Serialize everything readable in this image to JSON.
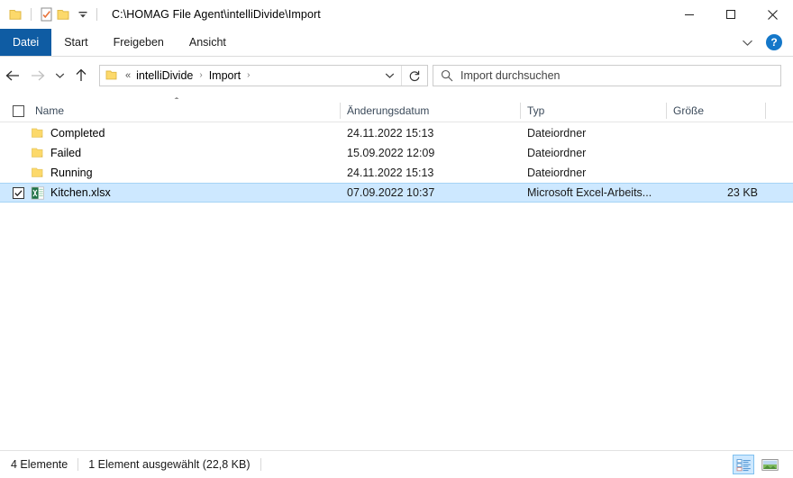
{
  "window": {
    "title": "C:\\HOMAG File Agent\\intelliDivide\\Import",
    "quick_access": [
      {
        "name": "folder-icon",
        "label": "Eigenschaften"
      },
      {
        "name": "properties-icon",
        "label": "Eigenschaften"
      },
      {
        "name": "new-folder-icon",
        "label": "Neuer Ordner"
      },
      {
        "name": "chevron-down-icon",
        "label": "Symbolleiste für den Schnellzugriff anpassen"
      }
    ],
    "controls": {
      "minimize": "—",
      "maximize": "□",
      "close": "✕"
    }
  },
  "ribbon": {
    "tabs": [
      {
        "label": "Datei",
        "active": true
      },
      {
        "label": "Start",
        "active": false
      },
      {
        "label": "Freigeben",
        "active": false
      },
      {
        "label": "Ansicht",
        "active": false
      }
    ],
    "expand_label": "Menüband minimieren",
    "help_label": "?"
  },
  "navigation": {
    "back_label": "Zurück",
    "forward_label": "Vorwärts",
    "recent_label": "Zuletzt besuchte Orte",
    "up_label": "Eine Ebene nach oben",
    "breadcrumb": {
      "overflow": "«",
      "items": [
        "intelliDivide",
        "Import"
      ],
      "separator": "›"
    },
    "address_dropdown_label": "Vorherige Orte",
    "refresh_label": "Aktualisieren"
  },
  "search": {
    "placeholder": "Import durchsuchen",
    "icon": "search-icon"
  },
  "columns": [
    {
      "key": "name",
      "label": "Name",
      "sorted": true,
      "sort_direction": "asc"
    },
    {
      "key": "date",
      "label": "Änderungsdatum",
      "sorted": false
    },
    {
      "key": "type",
      "label": "Typ",
      "sorted": false
    },
    {
      "key": "size",
      "label": "Größe",
      "sorted": false
    }
  ],
  "files": [
    {
      "name": "Completed",
      "date": "24.11.2022 15:13",
      "type": "Dateiordner",
      "size": "",
      "icon": "folder-icon",
      "selected": false,
      "checked": false
    },
    {
      "name": "Failed",
      "date": "15.09.2022 12:09",
      "type": "Dateiordner",
      "size": "",
      "icon": "folder-icon",
      "selected": false,
      "checked": false
    },
    {
      "name": "Running",
      "date": "24.11.2022 15:13",
      "type": "Dateiordner",
      "size": "",
      "icon": "folder-icon",
      "selected": false,
      "checked": false
    },
    {
      "name": "Kitchen.xlsx",
      "date": "07.09.2022 10:37",
      "type": "Microsoft Excel-Arbeits...",
      "size": "23 KB",
      "icon": "excel-file-icon",
      "selected": true,
      "checked": true
    }
  ],
  "status": {
    "item_count": "4 Elemente",
    "selection": "1 Element ausgewählt (22,8 KB)",
    "views": [
      {
        "name": "details-view-button",
        "label": "Detailansicht",
        "active": true
      },
      {
        "name": "large-icons-view-button",
        "label": "Große Symbole",
        "active": false
      }
    ]
  },
  "colors": {
    "accent": "#0f5ca3",
    "selection": "#cde8ff",
    "selection_border": "#a6d4f5",
    "folder": "#ffd97d",
    "excel_green": "#1e7145",
    "help_blue": "#1477c9"
  }
}
